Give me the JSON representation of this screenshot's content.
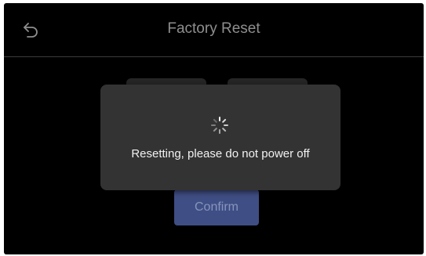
{
  "header": {
    "title": "Factory Reset",
    "back_icon": "back-arrow-icon"
  },
  "background": {
    "confirm_label": "Confirm",
    "confirm_color": "#3f4e84"
  },
  "dialog": {
    "message": "Resetting, please do not power off",
    "spinner_icon": "loading-spinner-icon"
  },
  "colors": {
    "screen_bg": "#000000",
    "dialog_bg": "#333333",
    "title_text": "#8e8e8e"
  }
}
